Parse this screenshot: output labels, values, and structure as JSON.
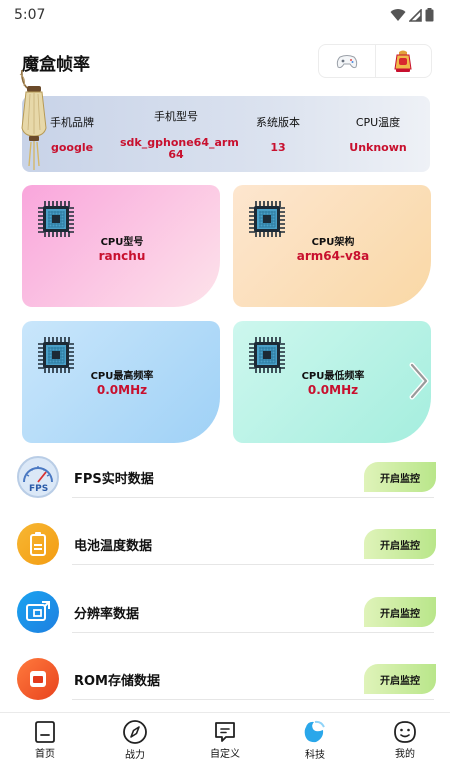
{
  "status_bar": {
    "time": "5:07"
  },
  "header": {
    "title": "魔盒帧率"
  },
  "device_info": [
    {
      "label": "手机品牌",
      "value": "google"
    },
    {
      "label": "手机型号",
      "value": "sdk_gphone64_arm\n64"
    },
    {
      "label": "系统版本",
      "value": "13"
    },
    {
      "label": "CPU温度",
      "value": "Unknown"
    }
  ],
  "cpu_cards": [
    {
      "label": "CPU型号",
      "value": "ranchu",
      "gradient": [
        "#f9a6dc",
        "#fde3ea"
      ]
    },
    {
      "label": "CPU架构",
      "value": "arm64-v8a",
      "gradient": [
        "#fde6cf",
        "#f9d8a6"
      ]
    },
    {
      "label": "CPU最高频率",
      "value": "0.0MHz",
      "gradient": [
        "#9fd1f6",
        "#c9e6fb"
      ]
    },
    {
      "label": "CPU最低频率",
      "value": "0.0MHz",
      "gradient": [
        "#cdf7ee",
        "#a5eede"
      ]
    }
  ],
  "monitors": [
    {
      "label": "FPS实时数据",
      "button": "开启监控",
      "icon": "fps-gauge-icon"
    },
    {
      "label": "电池温度数据",
      "button": "开启监控",
      "icon": "battery-icon"
    },
    {
      "label": "分辨率数据",
      "button": "开启监控",
      "icon": "resolution-icon"
    },
    {
      "label": "ROM存储数据",
      "button": "开启监控",
      "icon": "storage-icon"
    }
  ],
  "bottom_nav": [
    {
      "label": "首页",
      "icon": "home-icon"
    },
    {
      "label": "战力",
      "icon": "compass-icon"
    },
    {
      "label": "自定义",
      "icon": "message-icon"
    },
    {
      "label": "科技",
      "icon": "tech-icon"
    },
    {
      "label": "我的",
      "icon": "profile-icon"
    }
  ],
  "colors": {
    "accent_red": "#c8102e",
    "button_green": "#b9e68a"
  }
}
